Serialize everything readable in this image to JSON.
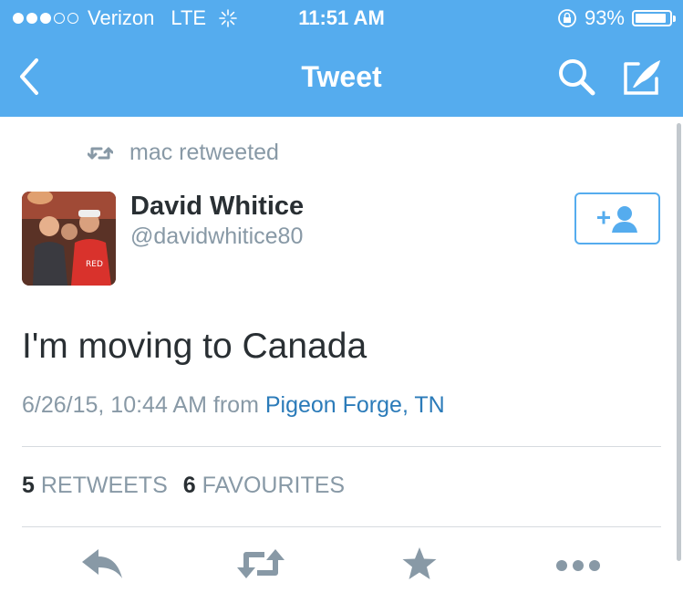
{
  "status": {
    "carrier": "Verizon",
    "network": "LTE",
    "time": "11:51 AM",
    "battery": "93%",
    "battery_level": 0.93
  },
  "nav": {
    "title": "Tweet"
  },
  "tweet": {
    "retweeted_by": "mac retweeted",
    "author_name": "David Whitice",
    "author_handle": "@davidwhitice80",
    "text": "I'm moving to Canada",
    "timestamp": "6/26/15, 10:44 AM",
    "from_label": "from",
    "location": "Pigeon Forge, TN",
    "retweets_count": "5",
    "retweets_label": "RETWEETS",
    "favourites_count": "6",
    "favourites_label": "FAVOURITES"
  },
  "icons": [
    "back-icon",
    "search-icon",
    "compose-icon",
    "retweet-icon",
    "follow-icon",
    "reply-icon",
    "favourite-icon",
    "more-icon"
  ],
  "colors": {
    "brand": "#55acee",
    "link": "#2b7bb9",
    "muted": "#8899a6",
    "text": "#292f33"
  }
}
